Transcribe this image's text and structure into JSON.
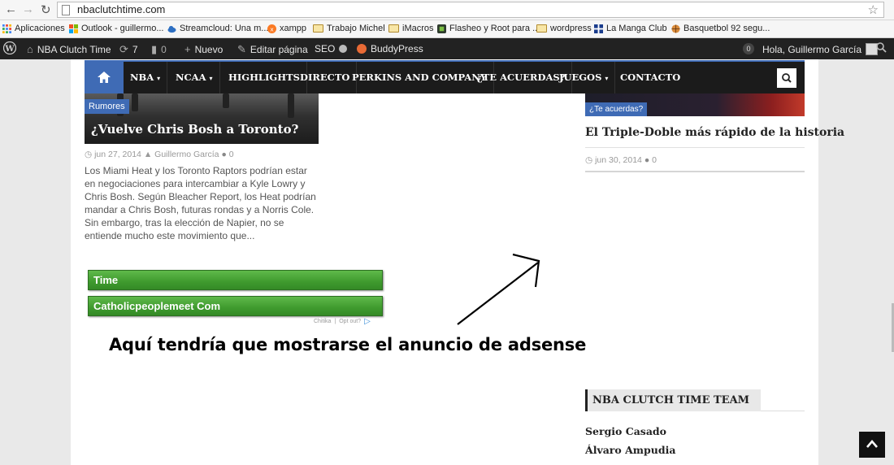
{
  "browser": {
    "url": "nbaclutchtime.com",
    "bookmarks": [
      {
        "label": "Aplicaciones",
        "icon": "apps-grid-icon"
      },
      {
        "label": "Outlook - guillermo...",
        "icon": "windows-icon"
      },
      {
        "label": "Streamcloud: Una m...",
        "icon": "cloud-icon"
      },
      {
        "label": "xampp",
        "icon": "xampp-icon"
      },
      {
        "label": "Trabajo Michel",
        "icon": "folder-icon"
      },
      {
        "label": "iMacros",
        "icon": "folder-icon"
      },
      {
        "label": "Flasheo y Root para ...",
        "icon": "android-icon"
      },
      {
        "label": "wordpress",
        "icon": "folder-icon"
      },
      {
        "label": "La Manga Club",
        "icon": "flag-icon"
      },
      {
        "label": "Basquetbol 92 segu...",
        "icon": "basketball-icon"
      }
    ]
  },
  "adminbar": {
    "site_name": "NBA Clutch Time",
    "updates_count": "7",
    "comments_count": "0",
    "new_label": "Nuevo",
    "edit_label": "Editar página",
    "seo_label": "SEO",
    "buddypress_label": "BuddyPress",
    "notifications_count": "0",
    "greeting": "Hola, Guillermo García"
  },
  "nav": {
    "items": [
      "NBA",
      "NCAA",
      "HIGHLIGHTS",
      "DIRECTO",
      "PERKINS AND COMPANY",
      "¿TE ACUERDAS?",
      "JUEGOS",
      "CONTACTO"
    ],
    "dropdown_marker": "▾"
  },
  "left_article": {
    "category": "Rumores",
    "title": "¿Vuelve Chris Bosh a Toronto?",
    "date": "jun 27, 2014",
    "author": "Guillermo García",
    "comments": "0",
    "excerpt": "Los Miami Heat y los Toronto Raptors podrían estar en negociaciones para intercambiar a Kyle Lowry y Chris Bosh. Según Bleacher Report, los Heat podrían mandar a Chris Bosh, futuras rondas y a Norris Cole.  Sin embargo, tras la elección de Napier, no se entiende mucho este movimiento que..."
  },
  "ad": {
    "link1": "Time",
    "link2": "Catholicpeoplemeet Com",
    "footer_brand": "Chitika",
    "footer_optout": "Opt out?"
  },
  "annotation": "Aquí tendría que mostrarse el anuncio de adsense",
  "right_article": {
    "category": "¿Te acuerdas?",
    "title": "El Triple-Doble más rápido de la historia",
    "date": "jun 30, 2014",
    "comments": "0"
  },
  "team_widget": {
    "title": "NBA CLUTCH TIME TEAM",
    "members": [
      "Sergio Casado",
      "Álvaro Ampudia"
    ]
  },
  "colors": {
    "accent_blue": "#3f6bb5",
    "nav_bg": "#1b1b1b",
    "ad_green": "#3f9a2e"
  }
}
